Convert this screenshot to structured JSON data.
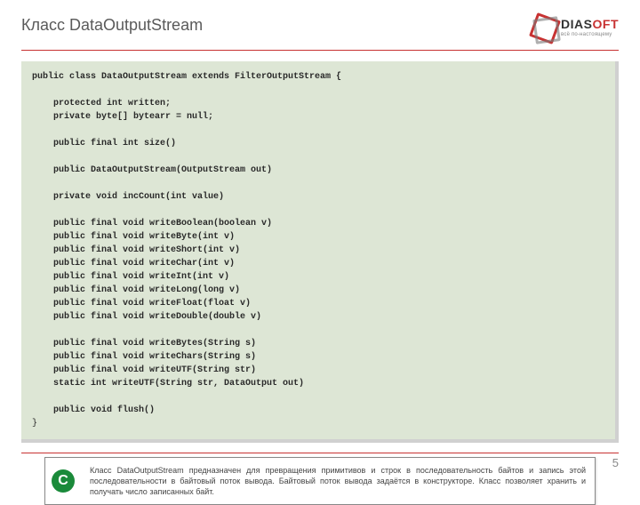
{
  "header": {
    "title": "Класс DataOutputStream",
    "logo": {
      "main_a": "DIAS",
      "main_b": "OFT",
      "sub": "всё по-настоящему"
    }
  },
  "code": {
    "l1": "public class DataOutputStream extends FilterOutputStream {",
    "l2": "",
    "l3": "    protected int written;",
    "l4": "    private byte[] bytearr = null;",
    "l5": "",
    "l6": "    public final int size()",
    "l7": "",
    "l8": "    public DataOutputStream(OutputStream out)",
    "l9": "",
    "l10": "    private void incCount(int value)",
    "l11": "",
    "l12": "    public final void writeBoolean(boolean v)",
    "l13": "    public final void writeByte(int v)",
    "l14": "    public final void writeShort(int v)",
    "l15": "    public final void writeChar(int v)",
    "l16": "    public final void writeInt(int v)",
    "l17": "    public final void writeLong(long v)",
    "l18": "    public final void writeFloat(float v)",
    "l19": "    public final void writeDouble(double v)",
    "l20": "",
    "l21": "    public final void writeBytes(String s)",
    "l22": "    public final void writeChars(String s)",
    "l23": "    public final void writeUTF(String str)",
    "l24": "    static int writeUTF(String str, DataOutput out)",
    "l25": "",
    "l26": "    public void flush()",
    "l27": "}"
  },
  "description": {
    "badge": "C",
    "text": "Класс DataOutputStream предназначен для превращения примитивов и строк в последовательность байтов и запись этой последовательности в байтовый поток вывода. Байтовый поток вывода задаётся в конструкторе. Класс позволяет хранить и получать число записанных байт."
  },
  "footer": {
    "page": "5"
  }
}
